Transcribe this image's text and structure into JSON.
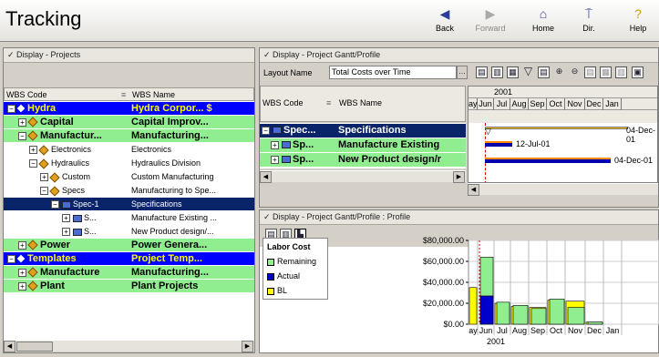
{
  "app": {
    "title": "Tracking"
  },
  "nav": {
    "back": "Back",
    "forward": "Forward",
    "home": "Home",
    "dir": "Dir.",
    "help": "Help"
  },
  "projects_panel": {
    "header": "Display - Projects",
    "col_wbs_code": "WBS Code",
    "col_wbs_name": "WBS Name",
    "rows": [
      {
        "code": "Hydra",
        "name": "Hydra Corpor... $",
        "style": "blue",
        "indent": 0,
        "exp": "−"
      },
      {
        "code": "Capital",
        "name": "Capital Improv...",
        "style": "green",
        "indent": 1,
        "exp": "+"
      },
      {
        "code": "Manufactur...",
        "name": "Manufacturing...",
        "style": "green",
        "indent": 1,
        "exp": "−"
      },
      {
        "code": "Electronics",
        "name": "Electronics",
        "style": "white",
        "indent": 2,
        "exp": "+"
      },
      {
        "code": "Hydraulics",
        "name": "Hydraulics Division",
        "style": "white",
        "indent": 2,
        "exp": "−"
      },
      {
        "code": "Custom",
        "name": "Custom Manufacturing",
        "style": "white",
        "indent": 3,
        "exp": "+"
      },
      {
        "code": "Specs",
        "name": "Manufacturing to Spe...",
        "style": "white",
        "indent": 3,
        "exp": "−"
      },
      {
        "code": "Spec-1",
        "name": "Specifications",
        "style": "sel",
        "indent": 4,
        "exp": "−"
      },
      {
        "code": "S...",
        "name": "Manufacture Existing ...",
        "style": "white",
        "indent": 5,
        "exp": "+"
      },
      {
        "code": "S...",
        "name": "New Product design/...",
        "style": "white",
        "indent": 5,
        "exp": "+"
      },
      {
        "code": "Power",
        "name": "Power Genera...",
        "style": "green",
        "indent": 1,
        "exp": "+"
      },
      {
        "code": "Templates",
        "name": "Project Temp...",
        "style": "blue",
        "indent": 0,
        "exp": "−"
      },
      {
        "code": "Manufacture",
        "name": "Manufacturing...",
        "style": "green",
        "indent": 1,
        "exp": "+"
      },
      {
        "code": "Plant",
        "name": "Plant Projects",
        "style": "green",
        "indent": 1,
        "exp": "+"
      }
    ]
  },
  "gantt_panel": {
    "header": "Display - Project Gantt/Profile",
    "layout_label": "Layout Name",
    "layout_value": "Total Costs over Time",
    "col_wbs_code": "WBS Code",
    "col_wbs_name": "WBS Name",
    "year": "2001",
    "months": [
      "ay",
      "Jun",
      "Jul",
      "Aug",
      "Sep",
      "Oct",
      "Nov",
      "Dec",
      "Jan"
    ],
    "rows": [
      {
        "code": "Spec...",
        "name": "Specifications",
        "style": "sel"
      },
      {
        "code": "Sp...",
        "name": "Manufacture Existing",
        "style": "green"
      },
      {
        "code": "Sp...",
        "name": "New Product design/r",
        "style": "green"
      }
    ],
    "bar_labels": [
      "04-Dec-01",
      "12-Jul-01",
      "04-Dec-01"
    ]
  },
  "profile_panel": {
    "header": "Display - Project Gantt/Profile : Profile"
  },
  "chart_data": {
    "type": "bar",
    "title": "Labor Cost",
    "legend": [
      {
        "name": "Remaining",
        "color": "#90ee90"
      },
      {
        "name": "Actual",
        "color": "#0000cc"
      },
      {
        "name": "BL",
        "color": "#ffff00"
      }
    ],
    "y_ticks": [
      "$80,000.00",
      "$60,000.00",
      "$40,000.00",
      "$20,000.00",
      "$0.00"
    ],
    "ylim": [
      0,
      80000
    ],
    "x_months": [
      "ay",
      "Jun",
      "Jul",
      "Aug",
      "Sep",
      "Oct",
      "Nov",
      "Dec",
      "Jan"
    ],
    "x_year": "2001",
    "series": [
      {
        "name": "BL",
        "values": [
          35000,
          0,
          20000,
          17000,
          16000,
          23000,
          22000,
          2000,
          0
        ]
      },
      {
        "name": "Remaining",
        "values": [
          0,
          64000,
          21000,
          18000,
          15000,
          24000,
          16000,
          2000,
          0
        ]
      },
      {
        "name": "Actual",
        "values": [
          0,
          27000,
          0,
          0,
          0,
          0,
          0,
          0,
          0
        ]
      }
    ]
  }
}
